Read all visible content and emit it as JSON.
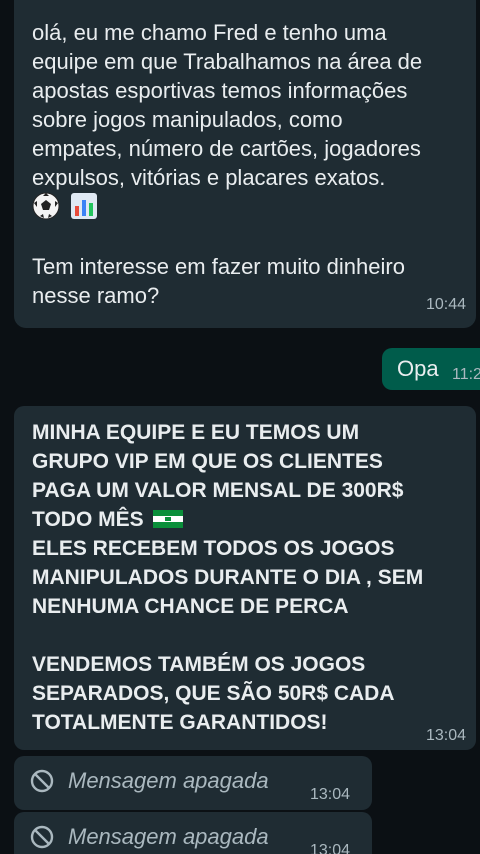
{
  "messages": [
    {
      "direction": "incoming",
      "lines": [
        "olá, eu me chamo Fred e tenho uma",
        "equipe em que Trabalhamos na área de",
        "apostas esportivas  temos informações",
        "sobre jogos manipulados, como",
        "empates, número de cartões, jogadores",
        "expulsos, vitórias  e placares exatos."
      ],
      "emojis": [
        "soccer-ball",
        "bar-chart"
      ],
      "question_lines": [
        "Tem interesse em fazer muito dinheiro",
        "nesse ramo?"
      ],
      "time": "10:44"
    },
    {
      "direction": "outgoing",
      "text": "Opa",
      "time": "11:2"
    },
    {
      "direction": "incoming",
      "lines": [
        "MINHA EQUIPE E EU TEMOS UM",
        "GRUPO VIP EM QUE OS CLIENTES",
        "PAGA UM VALOR MENSAL DE 300R$",
        "TODO MÊS"
      ],
      "lines2": [
        "ELES RECEBEM TODOS OS JOGOS",
        "MANIPULADOS DURANTE O DIA , SEM",
        "NENHUMA CHANCE DE PERCA"
      ],
      "lines3": [
        "VENDEMOS TAMBÉM OS JOGOS",
        "SEPARADOS, QUE SÃO 50R$ CADA",
        "TOTALMENTE GARANTIDOS!"
      ],
      "flag_icon": "flag-icon",
      "time": "13:04"
    },
    {
      "direction": "incoming",
      "deleted": true,
      "text": "Mensagem apagada",
      "time": "13:04"
    },
    {
      "direction": "incoming",
      "deleted": true,
      "text": "Mensagem apagada",
      "time": "13:04"
    }
  ],
  "colors": {
    "background": "#0b1014",
    "incoming_bubble": "#1f2c33",
    "outgoing_bubble": "#005c4b",
    "text": "#e9edef",
    "meta": "#aab8bf"
  }
}
